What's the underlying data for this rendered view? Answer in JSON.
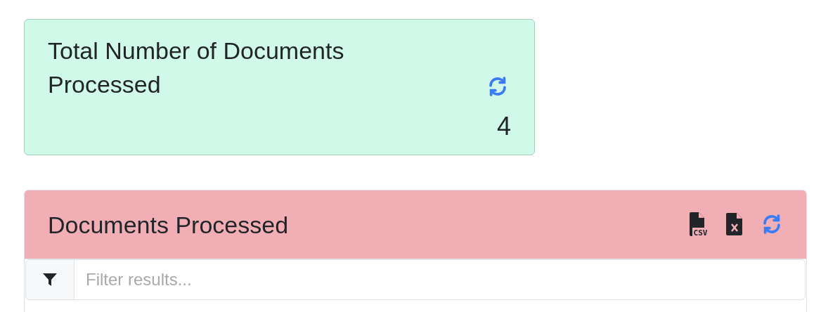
{
  "summary_card": {
    "title": "Total Number of Documents Processed",
    "value": "4"
  },
  "table_card": {
    "title": "Documents Processed",
    "csv_icon_label": "CSV",
    "filter": {
      "placeholder": "Filter results..."
    }
  }
}
